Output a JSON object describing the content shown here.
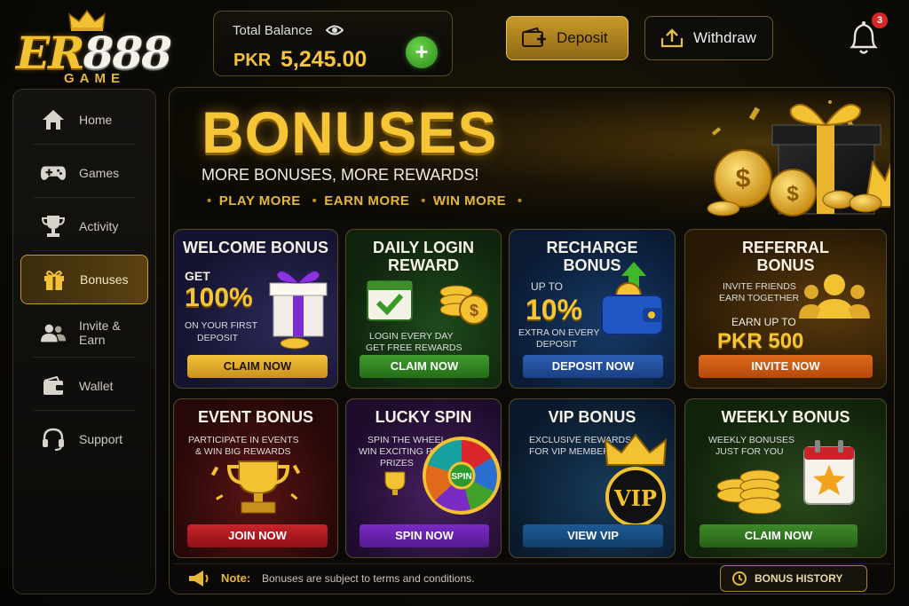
{
  "logo": {
    "brand_left": "ER",
    "brand_right": "888",
    "sub": "GAME"
  },
  "balance": {
    "label": "Total Balance",
    "currency": "PKR",
    "amount": "5,245.00"
  },
  "header": {
    "deposit_label": "Deposit",
    "withdraw_label": "Withdraw",
    "notification_count": "3"
  },
  "sidebar": {
    "items": [
      {
        "label": "Home",
        "icon": "home-icon"
      },
      {
        "label": "Games",
        "icon": "gamepad-icon"
      },
      {
        "label": "Activity",
        "icon": "trophy-icon"
      },
      {
        "label": "Bonuses",
        "icon": "gift-icon",
        "active": true
      },
      {
        "label": "Invite & Earn",
        "icon": "users-icon"
      },
      {
        "label": "Wallet",
        "icon": "wallet-icon"
      },
      {
        "label": "Support",
        "icon": "headset-icon"
      }
    ]
  },
  "hero": {
    "title": "BONUSES",
    "tagline": "MORE BONUSES, MORE REWARDS!",
    "points": [
      "PLAY MORE",
      "EARN MORE",
      "WIN MORE"
    ]
  },
  "cards": {
    "welcome": {
      "title": "WELCOME BONUS",
      "line1": "GET",
      "big": "100%",
      "line2": "ON YOUR FIRST",
      "line3": "DEPOSIT",
      "button": "CLAIM NOW"
    },
    "daily": {
      "title1": "DAILY LOGIN",
      "title2": "REWARD",
      "line1": "LOGIN EVERY DAY",
      "line2": "GET FREE REWARDS",
      "button": "CLAIM NOW"
    },
    "recharge": {
      "title1": "RECHARGE",
      "title2": "BONUS",
      "line1": "UP TO",
      "big": "10%",
      "line2": "EXTRA ON EVERY",
      "line3": "DEPOSIT",
      "button": "DEPOSIT NOW"
    },
    "referral": {
      "title1": "REFERRAL",
      "title2": "BONUS",
      "line1": "INVITE FRIENDS",
      "line2": "EARN TOGETHER",
      "line3": "EARN UP TO",
      "big": "PKR 500",
      "button": "INVITE NOW"
    },
    "event": {
      "title": "EVENT BONUS",
      "line1": "PARTICIPATE IN EVENTS",
      "line2": "& WIN BIG REWARDS",
      "button": "JOIN NOW"
    },
    "lucky": {
      "title": "LUCKY SPIN",
      "line1": "SPIN THE WHEEL",
      "line2": "WIN EXCITING PRIZES",
      "line3": "PRIZES",
      "wheel_label": "SPIN",
      "button": "SPIN NOW"
    },
    "vip": {
      "title": "VIP BONUS",
      "line1": "EXCLUSIVE REWARDS",
      "line2": "FOR VIP MEMBERS",
      "badge": "VIP",
      "button": "VIEW VIP"
    },
    "weekly": {
      "title": "WEEKLY BONUS",
      "line1": "WEEKLY BONUSES",
      "line2": "JUST FOR YOU",
      "button": "CLAIM NOW"
    }
  },
  "footer": {
    "note_label": "Note:",
    "note_text": "Bonuses are subject to terms and conditions.",
    "history_button": "BONUS HISTORY"
  }
}
